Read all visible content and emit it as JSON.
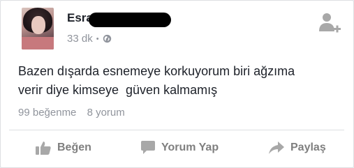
{
  "post": {
    "author_visible": "Esra",
    "time": "33 dk",
    "separator": "•",
    "privacy_icon": "globe-icon",
    "text": "Bazen dışarda esnemeye korkuyorum biri ağzıma\nverir diye kimseye  güven kalmamış",
    "likes": "99 beğenme",
    "comments": "8 yorum"
  },
  "actions": {
    "like": "Beğen",
    "comment": "Yorum Yap",
    "share": "Paylaş"
  },
  "colors": {
    "text": "#1d2129",
    "muted": "#90949c",
    "action": "#7f7f7f",
    "icon": "#a8a8a8"
  }
}
